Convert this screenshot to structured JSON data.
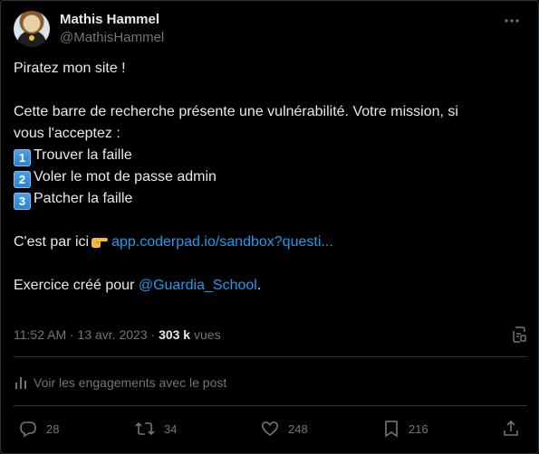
{
  "author": {
    "display_name": "Mathis Hammel",
    "handle": "@MathisHammel"
  },
  "tweet": {
    "line1": "Piratez mon site !",
    "line2": "Cette barre de recherche présente une vulnérabilité. Votre mission, si",
    "line3": "vous l'acceptez :",
    "steps": [
      {
        "badge": "1",
        "text": "Trouver la faille"
      },
      {
        "badge": "2",
        "text": "Voler le mot de passe admin"
      },
      {
        "badge": "3",
        "text": "Patcher la faille"
      }
    ],
    "cta_prefix": "C'est par ici",
    "cta_link": "app.coderpad.io/sandbox?questi...",
    "credit_prefix": "Exercice créé pour",
    "credit_mention": "@Guardia_School",
    "credit_suffix": "."
  },
  "meta": {
    "time_date": "11:52 AM · 13 avr. 2023 ·",
    "views_count": "303 k",
    "views_label": "vues"
  },
  "engagements": {
    "label": "Voir les engagements avec le post"
  },
  "actions": {
    "replies": "28",
    "reposts": "34",
    "likes": "248",
    "bookmarks": "216"
  },
  "colors": {
    "background": "#000000",
    "text": "#e7e9ea",
    "muted": "#71767b",
    "link": "#1d9bf0",
    "border": "#2f3336"
  },
  "icons": [
    "more-icon",
    "point-right-emoji",
    "keycap-emoji",
    "views-icon",
    "engagements-icon",
    "reply-icon",
    "repost-icon",
    "like-icon",
    "bookmark-icon",
    "share-icon"
  ]
}
